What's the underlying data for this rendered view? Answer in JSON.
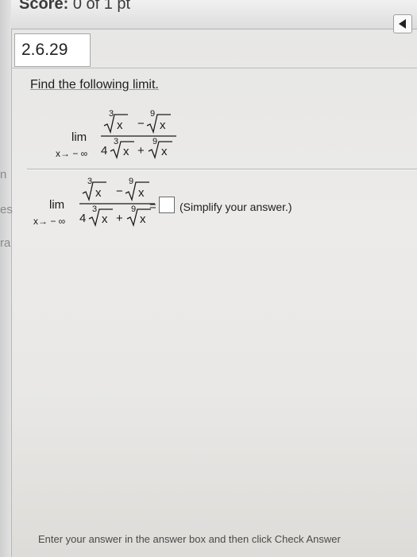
{
  "header": {
    "score_label": "Score:",
    "score_value": "0 of 1 pt",
    "collapse_icon": "triangle-left-icon"
  },
  "left_strip_fragments": [
    "n",
    "es",
    "ra"
  ],
  "question": {
    "number": "2.6.29",
    "instruction": "Find the following limit.",
    "limit": {
      "lim": "lim",
      "approach": "x→ − ∞",
      "numerator": {
        "term1_index": "3",
        "term1_radicand": "x",
        "operator": "−",
        "term2_index": "9",
        "term2_radicand": "x"
      },
      "denominator": {
        "coefficient": "4",
        "term1_index": "3",
        "term1_radicand": "x",
        "operator": "+",
        "term2_index": "9",
        "term2_radicand": "x"
      }
    }
  },
  "answer": {
    "equals": "=",
    "value": "",
    "hint": "(Simplify your answer.)"
  },
  "footer": {
    "hint": "Enter your answer in the answer box and then click Check Answer"
  }
}
